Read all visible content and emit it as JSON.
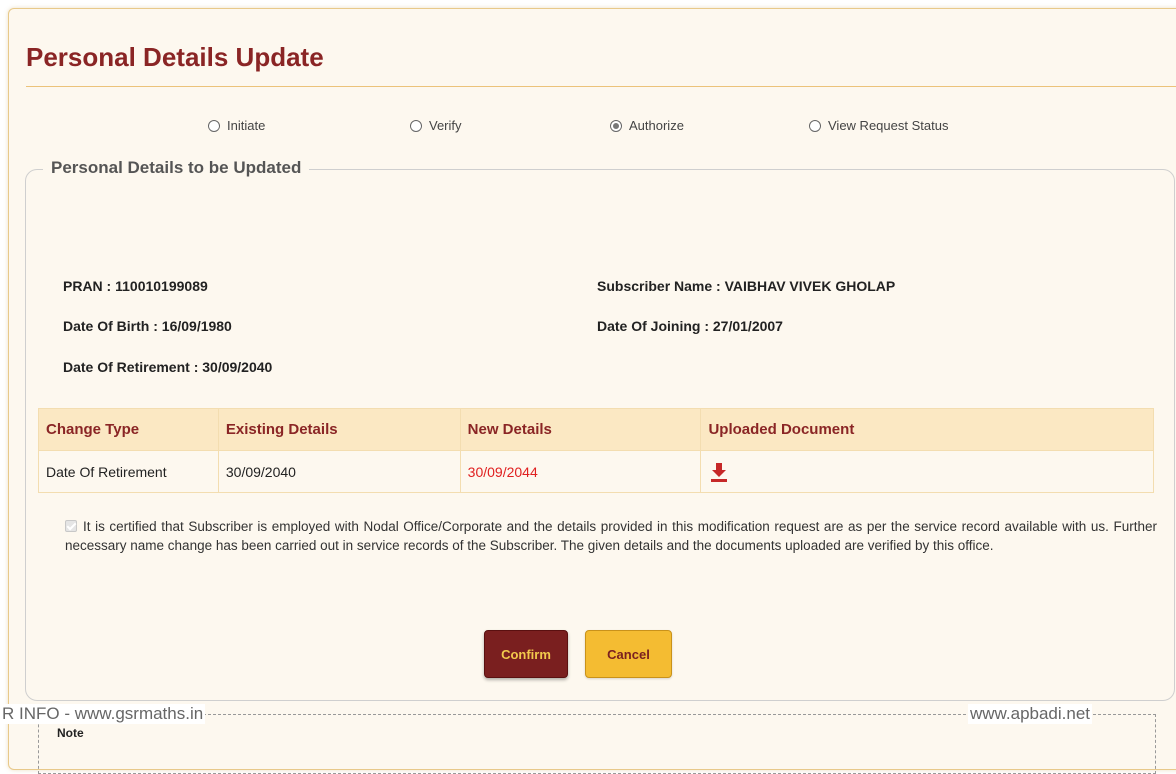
{
  "page": {
    "title": "Personal Details Update"
  },
  "workflow": {
    "options": [
      {
        "label": "Initiate",
        "checked": false
      },
      {
        "label": "Verify",
        "checked": false
      },
      {
        "label": "Authorize",
        "checked": true
      },
      {
        "label": "View Request Status",
        "checked": false
      }
    ]
  },
  "section": {
    "legend": "Personal Details to be Updated"
  },
  "subscriber": {
    "pran": "PRAN : 110010199089",
    "name": "Subscriber Name : VAIBHAV VIVEK GHOLAP",
    "dob": "Date Of Birth : 16/09/1980",
    "doj": "Date Of Joining : 27/01/2007",
    "dor": "Date Of Retirement : 30/09/2040"
  },
  "changes_table": {
    "headers": [
      "Change Type",
      "Existing Details",
      "New Details",
      "Uploaded Document"
    ],
    "rows": [
      {
        "change_type": "Date Of Retirement",
        "existing": "30/09/2040",
        "new": "30/09/2044",
        "document_icon": "download-icon"
      }
    ]
  },
  "certification": {
    "checked": true,
    "text": "It is certified that Subscriber is employed with Nodal Office/Corporate and the details provided in this modification request are as per the service record available with us. Further necessary name change has been carried out in service records of the Subscriber. The given details and the documents uploaded are verified by this office."
  },
  "buttons": {
    "confirm": "Confirm",
    "cancel": "Cancel"
  },
  "note": {
    "label": "Note"
  },
  "watermarks": {
    "left": "R INFO - www.gsrmaths.in",
    "right": "www.apbadi.net"
  },
  "colors": {
    "brand_maroon": "#8a2525",
    "accent_gold": "#f4bc32",
    "new_value_red": "#e02020",
    "panel_bg": "#fdf8ef",
    "table_header_bg": "#fbe8c3"
  }
}
